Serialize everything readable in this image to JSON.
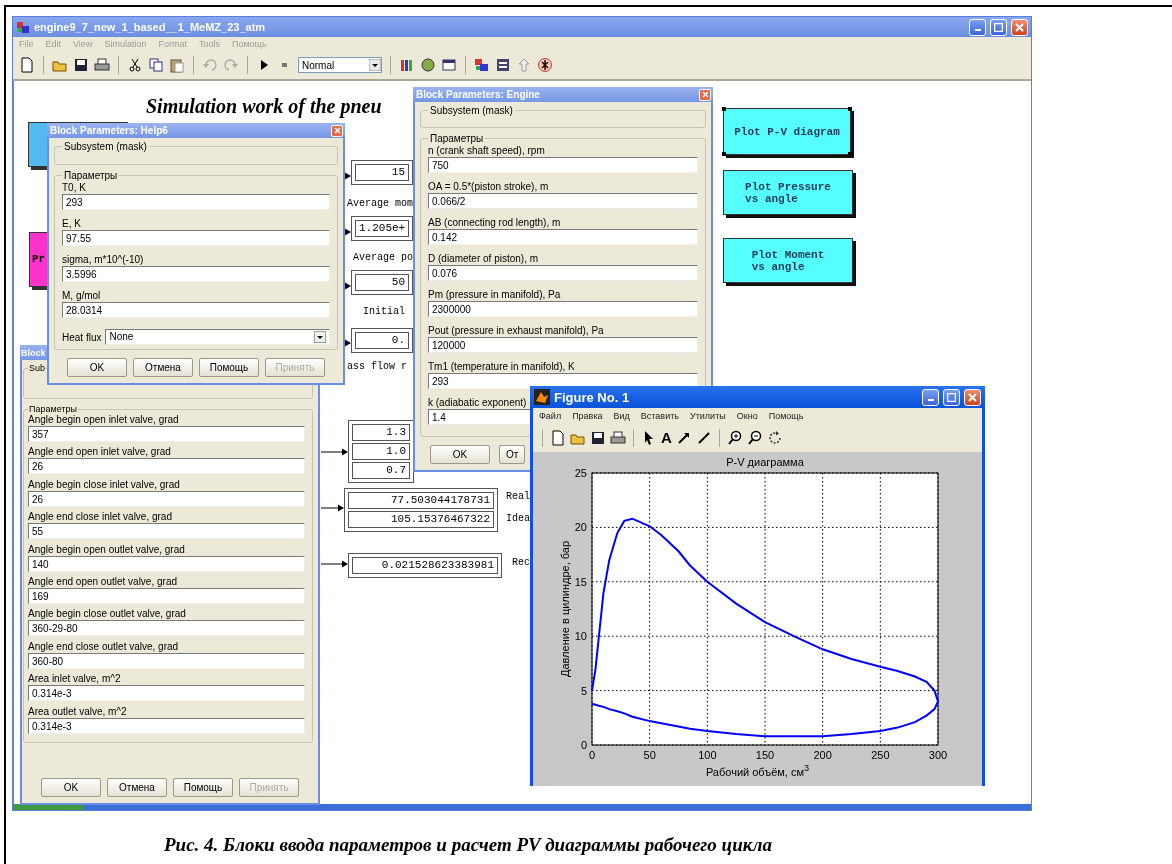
{
  "window": {
    "title": "engine9_7_new_1_based__1_MeMZ_23_atm",
    "menu": [
      "File",
      "Edit",
      "View",
      "Simulation",
      "Format",
      "Tools",
      "Помощь"
    ],
    "sim_mode": "Normal"
  },
  "canvas": {
    "heading": "Simulation work of the pneu",
    "blocks": [
      {
        "kind": "subsystem",
        "color": "#55b8f0"
      },
      {
        "kind": "subsystem",
        "color": "#ff33cc",
        "label": "Pr"
      }
    ],
    "displays": [
      {
        "values": [
          "15"
        ],
        "label": "Average mom"
      },
      {
        "values": [
          "1.205e+"
        ],
        "label": "Average po"
      },
      {
        "values": [
          "50"
        ],
        "label": "Initial"
      },
      {
        "values": [
          "0."
        ],
        "label": "ass flow r"
      },
      {
        "values": [
          "1.3",
          "1.0",
          "0.7"
        ]
      },
      {
        "values": [
          "77.503044178731",
          "105.15376467322"
        ],
        "side_labels": [
          "Real",
          "Idea"
        ]
      },
      {
        "values": [
          "0.021528623383981"
        ],
        "side_labels": [
          "Rec"
        ]
      }
    ],
    "plot_buttons": [
      {
        "lines": [
          "Plot P-V diagram"
        ],
        "selected": true
      },
      {
        "lines": [
          "Plot Pressure",
          "vs angle"
        ],
        "selected": false
      },
      {
        "lines": [
          "Plot Moment",
          "vs angle"
        ],
        "selected": false
      }
    ]
  },
  "dialogs": [
    {
      "title": "Block Parameters: Help6",
      "mask": "Subsystem (mask)",
      "group": "Параметры",
      "params": [
        {
          "kind": "edit",
          "label": "T0, K",
          "value": "293"
        },
        {
          "kind": "edit",
          "label": "E, K",
          "value": "97.55"
        },
        {
          "kind": "edit",
          "label": "sigma, m*10^(-10)",
          "value": "3.5996"
        },
        {
          "kind": "edit",
          "label": "M, g/mol",
          "value": "28.0314"
        },
        {
          "kind": "popup",
          "label": "Heat flux",
          "value": "None"
        }
      ],
      "buttons": [
        {
          "label": "OK",
          "disabled": false
        },
        {
          "label": "Отмена",
          "disabled": false
        },
        {
          "label": "Помощь",
          "disabled": false
        },
        {
          "label": "Принять",
          "disabled": true
        }
      ]
    },
    {
      "title": "Block",
      "mask": "Sub",
      "group": "Параметры",
      "params": [
        {
          "kind": "edit",
          "label": "Angle begin open inlet valve, grad",
          "value": "357"
        },
        {
          "kind": "edit",
          "label": "Angle end open inlet valve, grad",
          "value": "26"
        },
        {
          "kind": "edit",
          "label": "Angle begin close inlet valve, grad",
          "value": "26"
        },
        {
          "kind": "edit",
          "label": "Angle end close inlet valve, grad",
          "value": "55"
        },
        {
          "kind": "edit",
          "label": "Angle begin open outlet valve, grad",
          "value": "140"
        },
        {
          "kind": "edit",
          "label": "Angle end open outlet valve, grad",
          "value": "169"
        },
        {
          "kind": "edit",
          "label": "Angle begin close outlet valve, grad",
          "value": "360-29-80"
        },
        {
          "kind": "edit",
          "label": "Angle end close outlet valve, grad",
          "value": "360-80"
        },
        {
          "kind": "edit",
          "label": "Area inlet valve, m^2",
          "value": "0.314e-3"
        },
        {
          "kind": "edit",
          "label": "Area outlet valve, m^2",
          "value": "0.314e-3"
        }
      ],
      "buttons": [
        {
          "label": "OK",
          "disabled": false
        },
        {
          "label": "Отмена",
          "disabled": false
        },
        {
          "label": "Помощь",
          "disabled": false
        },
        {
          "label": "Принять",
          "disabled": true
        }
      ]
    },
    {
      "title": "Block Parameters: Engine",
      "mask": "Subsystem (mask)",
      "group": "Параметры",
      "params": [
        {
          "kind": "edit",
          "label": "n (crank shaft speed), rpm",
          "value": "750"
        },
        {
          "kind": "edit",
          "label": "OA = 0.5*(piston stroke), m",
          "value": "0.066/2"
        },
        {
          "kind": "edit",
          "label": "AB (connecting rod length), m",
          "value": "0.142"
        },
        {
          "kind": "edit",
          "label": "D (diameter of piston), m",
          "value": "0.076"
        },
        {
          "kind": "edit",
          "label": "Pm (pressure in manifold), Pa",
          "value": "2300000"
        },
        {
          "kind": "edit",
          "label": "Pout (pressure in exhaust manifold), Pa",
          "value": "120000"
        },
        {
          "kind": "edit",
          "label": "Tm1 (temperature in manifold), K",
          "value": "293"
        },
        {
          "kind": "edit",
          "label": "k (adiabatic exponent)",
          "value": "1.4"
        }
      ],
      "buttons": [
        {
          "label": "OK",
          "disabled": false
        },
        {
          "label": "От",
          "disabled": false
        }
      ]
    }
  ],
  "figure": {
    "title": "Figure No. 1",
    "menu": [
      "Файл",
      "Правка",
      "Вид",
      "Вставить",
      "Утилиты",
      "Окно",
      "Помощь"
    ],
    "text_tool": "A",
    "chart_data": {
      "type": "line",
      "title": "P-V диаграмма",
      "xlabel": "Рабочий объём, см$^{3}$",
      "ylabel": "Давление в цилиндре, бар",
      "x": [
        0,
        3,
        6,
        10,
        15,
        22,
        28,
        35,
        50,
        60,
        75,
        85,
        100,
        125,
        150,
        175,
        200,
        225,
        250,
        265,
        280,
        290,
        297,
        300
      ],
      "series": [
        {
          "color": "#0000ff",
          "values": [
            3.8,
            3.7,
            3.6,
            3.5,
            3.3,
            3.1,
            2.9,
            2.6,
            2.2,
            2,
            1.7,
            1.5,
            1.3,
            1,
            0.8,
            0.8,
            0.8,
            1,
            1.3,
            1.6,
            2.1,
            2.7,
            3.3,
            4
          ]
        },
        {
          "color": "#0000ff",
          "values": [
            5,
            7,
            10,
            14,
            17,
            19.5,
            20.6,
            20.8,
            20.1,
            19.3,
            17.8,
            16.5,
            15,
            13,
            11.3,
            10,
            8.8,
            7.9,
            7.2,
            6.8,
            6.3,
            5.8,
            5,
            4
          ]
        }
      ],
      "xlim": [
        0,
        300
      ],
      "ylim": [
        0,
        25
      ],
      "xticks": [
        0,
        50,
        100,
        150,
        200,
        250,
        300
      ],
      "yticks": [
        0,
        5,
        10,
        15,
        20,
        25
      ],
      "grid": true
    }
  },
  "caption": "Рис. 4. Блоки ввода параметров и расчет PV диаграммы рабочего цикла"
}
